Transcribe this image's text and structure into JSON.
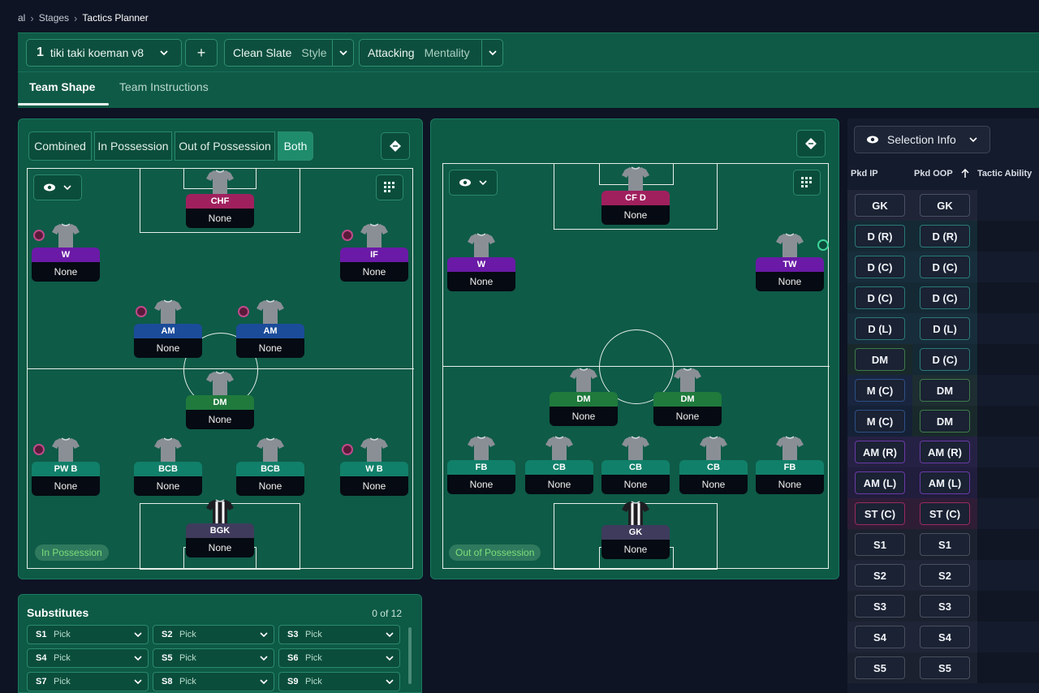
{
  "breadcrumb": {
    "items": [
      "al",
      "Stages",
      "Tactics Planner"
    ]
  },
  "toolbar": {
    "tactic_number": "1",
    "tactic_name": "tiki taki koeman v8",
    "add_label": "+",
    "style_value": "Clean Slate",
    "style_label": "Style",
    "mentality_value": "Attacking",
    "mentality_label": "Mentality"
  },
  "tabs": [
    {
      "label": "Team Shape",
      "active": true
    },
    {
      "label": "Team Instructions",
      "active": false
    }
  ],
  "left_panel": {
    "segments": [
      {
        "label": "Combined",
        "active": false
      },
      {
        "label": "In Possession",
        "active": false
      },
      {
        "label": "Out of Possession",
        "active": false
      },
      {
        "label": "Both",
        "active": true
      }
    ],
    "phase_label": "In Possession",
    "players": [
      {
        "role": "CHF",
        "name": "None",
        "color": "#a0205e"
      },
      {
        "role": "W",
        "name": "None",
        "color": "#6a1aa6"
      },
      {
        "role": "IF",
        "name": "None",
        "color": "#6a1aa6"
      },
      {
        "role": "AM",
        "name": "None",
        "color": "#1b4c9a"
      },
      {
        "role": "AM",
        "name": "None",
        "color": "#1b4c9a"
      },
      {
        "role": "DM",
        "name": "None",
        "color": "#1f7a3c"
      },
      {
        "role": "PW B",
        "name": "None",
        "color": "#11806a"
      },
      {
        "role": "BCB",
        "name": "None",
        "color": "#11806a"
      },
      {
        "role": "BCB",
        "name": "None",
        "color": "#11806a"
      },
      {
        "role": "W B",
        "name": "None",
        "color": "#11806a"
      },
      {
        "role": "BGK",
        "name": "None",
        "color": "#3f3b5c"
      }
    ]
  },
  "right_panel": {
    "phase_label": "Out of Possession",
    "players": [
      {
        "role": "CF D",
        "name": "None",
        "color": "#a0205e"
      },
      {
        "role": "W",
        "name": "None",
        "color": "#6a1aa6"
      },
      {
        "role": "TW",
        "name": "None",
        "color": "#6a1aa6"
      },
      {
        "role": "DM",
        "name": "None",
        "color": "#1f7a3c"
      },
      {
        "role": "DM",
        "name": "None",
        "color": "#1f7a3c"
      },
      {
        "role": "FB",
        "name": "None",
        "color": "#11806a"
      },
      {
        "role": "CB",
        "name": "None",
        "color": "#11806a"
      },
      {
        "role": "CB",
        "name": "None",
        "color": "#11806a"
      },
      {
        "role": "CB",
        "name": "None",
        "color": "#11806a"
      },
      {
        "role": "FB",
        "name": "None",
        "color": "#11806a"
      },
      {
        "role": "GK",
        "name": "None",
        "color": "#3f3b5c"
      }
    ]
  },
  "substitutes": {
    "title": "Substitutes",
    "count": "0 of 12",
    "slots": [
      {
        "id": "S1",
        "value": "Pick"
      },
      {
        "id": "S2",
        "value": "Pick"
      },
      {
        "id": "S3",
        "value": "Pick"
      },
      {
        "id": "S4",
        "value": "Pick"
      },
      {
        "id": "S5",
        "value": "Pick"
      },
      {
        "id": "S6",
        "value": "Pick"
      },
      {
        "id": "S7",
        "value": "Pick"
      },
      {
        "id": "S8",
        "value": "Pick"
      },
      {
        "id": "S9",
        "value": "Pick"
      }
    ]
  },
  "selection": {
    "button_label": "Selection Info",
    "columns": [
      "Pkd IP",
      "Pkd OOP",
      "Tactic Ability"
    ],
    "rows": [
      {
        "ip": "GK",
        "oop": "GK",
        "ip_color": "#4a4f66",
        "oop_color": "#4a4f66"
      },
      {
        "ip": "D (R)",
        "oop": "D (R)",
        "ip_color": "#2a7a78",
        "oop_color": "#2a7a78"
      },
      {
        "ip": "D (C)",
        "oop": "D (C)",
        "ip_color": "#2a7a78",
        "oop_color": "#2a7a78"
      },
      {
        "ip": "D (C)",
        "oop": "D (C)",
        "ip_color": "#2a7a78",
        "oop_color": "#2a7a78"
      },
      {
        "ip": "D (L)",
        "oop": "D (L)",
        "ip_color": "#2a7a78",
        "oop_color": "#2a7a78"
      },
      {
        "ip": "DM",
        "oop": "D (C)",
        "ip_color": "#3f7a4a",
        "oop_color": "#2a7a78"
      },
      {
        "ip": "M (C)",
        "oop": "DM",
        "ip_color": "#2c4f86",
        "oop_color": "#3f7a4a"
      },
      {
        "ip": "M (C)",
        "oop": "DM",
        "ip_color": "#2c4f86",
        "oop_color": "#3f7a4a"
      },
      {
        "ip": "AM (R)",
        "oop": "AM (R)",
        "ip_color": "#6a3aa6",
        "oop_color": "#6a3aa6"
      },
      {
        "ip": "AM (L)",
        "oop": "AM (L)",
        "ip_color": "#6a3aa6",
        "oop_color": "#6a3aa6"
      },
      {
        "ip": "ST (C)",
        "oop": "ST (C)",
        "ip_color": "#9a2a5e",
        "oop_color": "#9a2a5e"
      },
      {
        "ip": "S1",
        "oop": "S1",
        "ip_color": "#4a4f5e",
        "oop_color": "#4a4f5e"
      },
      {
        "ip": "S2",
        "oop": "S2",
        "ip_color": "#4a4f5e",
        "oop_color": "#4a4f5e"
      },
      {
        "ip": "S3",
        "oop": "S3",
        "ip_color": "#4a4f5e",
        "oop_color": "#4a4f5e"
      },
      {
        "ip": "S4",
        "oop": "S4",
        "ip_color": "#4a4f5e",
        "oop_color": "#4a4f5e"
      },
      {
        "ip": "S5",
        "oop": "S5",
        "ip_color": "#4a4f5e",
        "oop_color": "#4a4f5e"
      }
    ]
  }
}
